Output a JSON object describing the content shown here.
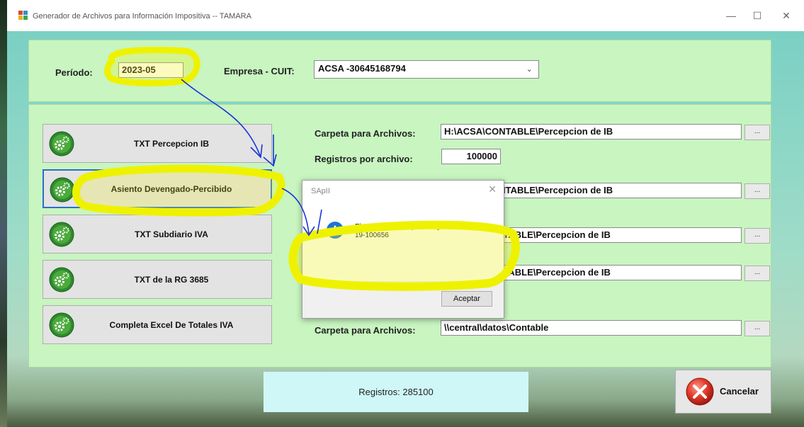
{
  "window": {
    "title": "Generador de Archivos para Información Impositiva   --  TAMARA",
    "minimize": "—",
    "maximize": "☐",
    "close": "✕"
  },
  "header": {
    "periodo_label": "Período:",
    "periodo_value": "2023-05",
    "empresa_label": "Empresa - CUIT:",
    "empresa_value": "ACSA  -30645168794"
  },
  "actions": [
    {
      "label": "TXT Percepcion IB"
    },
    {
      "label": "Asiento Devengado-Percibido"
    },
    {
      "label": "TXT Subdiario IVA"
    },
    {
      "label": "TXT de la RG 3685"
    },
    {
      "label": "Completa Excel De Totales IVA"
    }
  ],
  "fields": {
    "carpeta_label": "Carpeta para Archivos:",
    "registros_label": "Registros por archivo:",
    "registros_value": "100000",
    "paths": [
      "H:\\ACSA\\CONTABLE\\Percepcion de IB",
      "H:\\ACSA\\CONTABLE\\Percepcion de IB",
      "NTABLE\\Percepcion de IB",
      "NTABLE\\Percepcion de IB",
      "\\\\central\\datos\\Contable"
    ],
    "browse_label": "..."
  },
  "status": {
    "text": "Registros: 285100"
  },
  "cancel": {
    "label": "Cancelar"
  },
  "dialog": {
    "title": "SApII",
    "close": "✕",
    "message_line1": "El asiento para el periodo ya existe",
    "message_line2": "19-100656",
    "ok_label": "Aceptar"
  },
  "icons": [
    "app-icon",
    "gear-icon",
    "info-icon",
    "cancel-x-icon"
  ],
  "colors": {
    "panel": "#c8f5c0",
    "status_box": "#cff7f7",
    "focus_border": "#2b6fc9",
    "highlighter": "#f2f200",
    "pen": "#1a35d8"
  }
}
